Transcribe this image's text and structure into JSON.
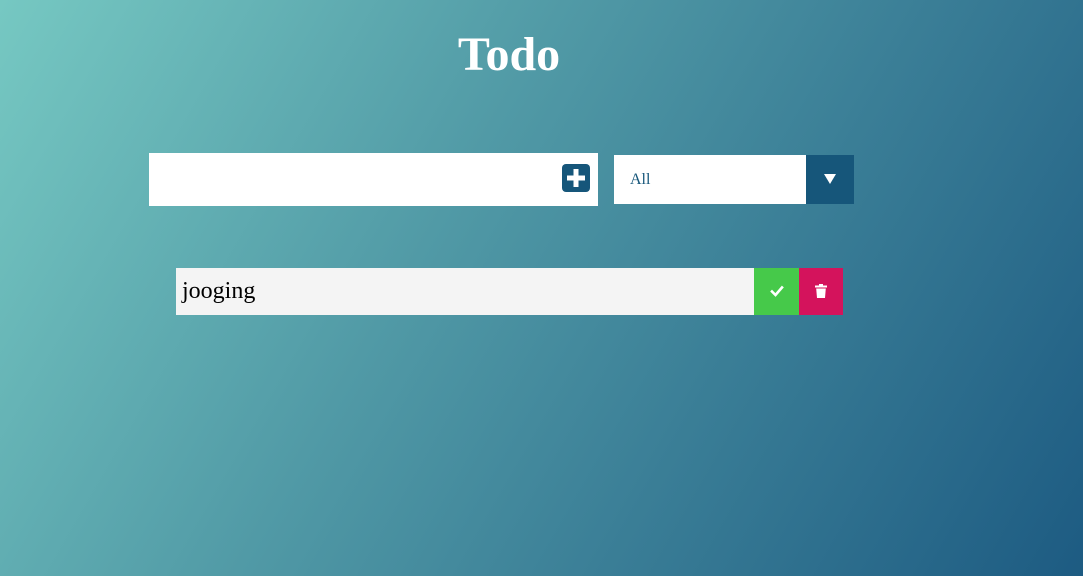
{
  "app": {
    "title": "Todo"
  },
  "input": {
    "value": "",
    "placeholder": "",
    "add_icon": "plus-square-icon"
  },
  "filter": {
    "selected": "All",
    "arrow_icon": "caret-down-icon"
  },
  "todos": [
    {
      "text": "jooging",
      "complete_icon": "check-icon",
      "delete_icon": "trash-icon"
    }
  ],
  "colors": {
    "accent": "#16567a",
    "complete": "#46c94a",
    "delete": "#d4135c",
    "item_background": "#f4f4f4",
    "gradient_start": "#76c8c2",
    "gradient_end": "#1d5b82"
  }
}
